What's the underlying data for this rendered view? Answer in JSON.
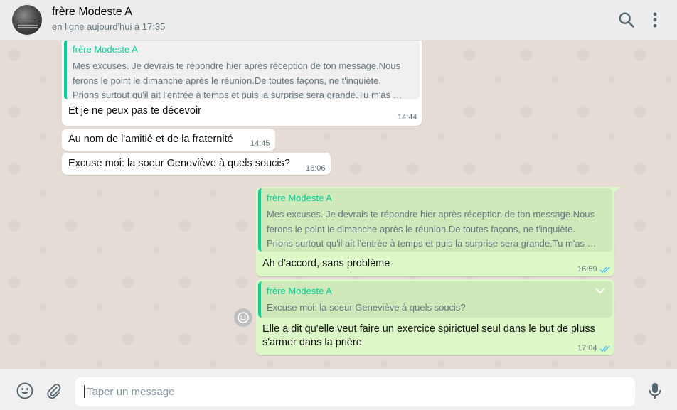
{
  "header": {
    "contact_name": "frère Modeste A",
    "status": "en ligne aujourd'hui à 17:35",
    "avatar_icon": "avatar-image",
    "search_icon": "search-icon",
    "menu_icon": "more-vertical-icon"
  },
  "messages": [
    {
      "direction": "in",
      "quoted": {
        "author": "frère Modeste A",
        "lines": [
          "Mes excuses. Je devrais te répondre hier après réception  de ton message.Nous",
          "ferons le point le dimanche après le réunion.De toutes façons, ne t'inquiète.",
          "Prions surtout qu'il ait l'entrée à temps et puis la surprise sera grande.Tu m'as …"
        ]
      },
      "text": "Et je ne peux pas te décevoir",
      "time": "14:44"
    },
    {
      "direction": "in",
      "text": "Au nom de l'amitié et de la fraternité",
      "time": "14:45"
    },
    {
      "direction": "in",
      "text": "Excuse moi: la soeur Geneviève à quels soucis?",
      "time": "16:06"
    },
    {
      "direction": "out",
      "quoted": {
        "author": "frère Modeste A",
        "lines": [
          "Mes excuses. Je devrais te répondre hier après réception  de ton message.Nous",
          "ferons le point le dimanche après le réunion.De toutes façons, ne t'inquiète.",
          "Prions surtout qu'il ait l'entrée à temps et puis la surprise sera grande.Tu m'as …"
        ]
      },
      "text": "Ah d'accord, sans problème",
      "time": "16:59",
      "status": "read"
    },
    {
      "direction": "out",
      "quoted": {
        "author": "frère Modeste A",
        "lines": [
          "Excuse moi: la soeur Geneviève à quels soucis?"
        ]
      },
      "text_lines": [
        "Elle a dit qu'elle veut faire un exercice spirictuel seul dans le but de pluss",
        "s'armer dans la prière"
      ],
      "time": "17:04",
      "status": "read"
    }
  ],
  "composer": {
    "placeholder": "Taper un message",
    "emoji_icon": "emoji-icon",
    "attach_icon": "paperclip-icon",
    "mic_icon": "microphone-icon"
  },
  "colors": {
    "incoming_bubble": "#ffffff",
    "outgoing_bubble": "#dcf8c6",
    "quote_accent": "#06cf9c",
    "read_ticks": "#53bdeb",
    "chat_background": "#e5ddd5"
  }
}
